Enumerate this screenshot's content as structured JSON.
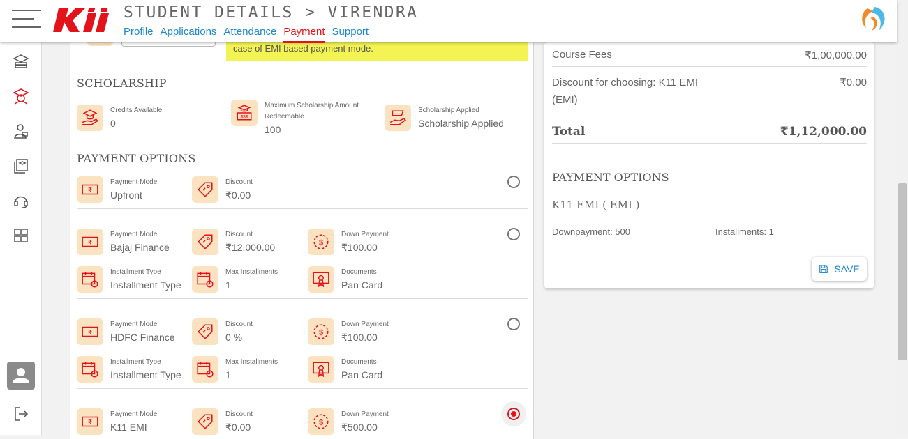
{
  "header": {
    "title": "STUDENT DETAILS > VIRENDRA",
    "logo_text": "K11",
    "tabs": [
      {
        "label": "Profile"
      },
      {
        "label": "Applications"
      },
      {
        "label": "Attendance"
      },
      {
        "label": "Payment"
      },
      {
        "label": "Support"
      }
    ],
    "active_tab": "Payment"
  },
  "sidebar": {
    "icons": [
      "courses-icon",
      "student-cap-icon",
      "teacher-icon",
      "library-icon",
      "headset-icon",
      "grid-icon",
      "user-avatar-icon",
      "logout-icon"
    ]
  },
  "emi_note": "case of EMI based payment mode.",
  "scholarship": {
    "heading": "SCHOLARSHIP",
    "items": [
      {
        "label": "Credits Available",
        "value": "0"
      },
      {
        "label": "Maximum Scholarship Amount Redeemable",
        "value": "100"
      },
      {
        "label": "Scholarship Applied",
        "value": "Scholarship Applied"
      }
    ]
  },
  "payment_options": {
    "heading": "PAYMENT OPTIONS",
    "options": [
      {
        "mode_label": "Payment Mode",
        "mode": "Upfront",
        "discount_label": "Discount",
        "discount": "₹0.00",
        "selected": false
      },
      {
        "mode_label": "Payment Mode",
        "mode": "Bajaj Finance",
        "discount_label": "Discount",
        "discount": "₹12,000.00",
        "down_label": "Down Payment",
        "down": "₹100.00",
        "inst_type_label": "Installment Type",
        "inst_type": "Installment Type",
        "max_inst_label": "Max Installments",
        "max_inst": "1",
        "docs_label": "Documents",
        "docs": "Pan Card",
        "selected": false
      },
      {
        "mode_label": "Payment Mode",
        "mode": "HDFC Finance",
        "discount_label": "Discount",
        "discount": "0 %",
        "down_label": "Down Payment",
        "down": "₹100.00",
        "inst_type_label": "Installment Type",
        "inst_type": "Installment Type",
        "max_inst_label": "Max Installments",
        "max_inst": "1",
        "docs_label": "Documents",
        "docs": "Pan Card",
        "selected": false
      },
      {
        "mode_label": "Payment Mode",
        "mode": "K11 EMI",
        "discount_label": "Discount",
        "discount": "₹0.00",
        "down_label": "Down Payment",
        "down": "₹500.00",
        "selected": true
      }
    ]
  },
  "summary": {
    "course_fees_label": "Course Fees",
    "course_fees": "₹1,00,000.00",
    "discount_label_1": "Discount for choosing: K11 EMI",
    "discount_label_2": "(EMI)",
    "discount": "₹0.00",
    "total_label": "Total",
    "total": "₹1,12,000.00",
    "options_heading": "PAYMENT OPTIONS",
    "selected_option": "K11 EMI ( EMI )",
    "downpayment": "Downpayment: 500",
    "installments": "Installments: 1",
    "save_label": "SAVE"
  },
  "colors": {
    "accent_red": "#e3121b",
    "link_blue": "#1e88c8",
    "icon_bg": "#fbe3c2",
    "note_yellow": "#f3f354"
  }
}
